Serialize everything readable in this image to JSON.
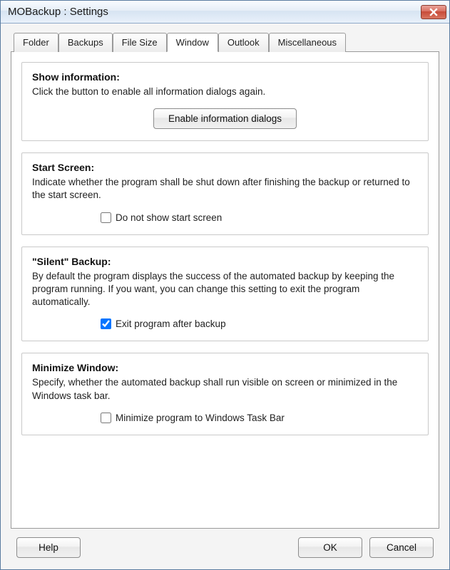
{
  "window": {
    "title": "MOBackup : Settings"
  },
  "tabs": {
    "folder": "Folder",
    "backups": "Backups",
    "filesize": "File Size",
    "window": "Window",
    "outlook": "Outlook",
    "misc": "Miscellaneous",
    "active": "window"
  },
  "groups": {
    "showInfo": {
      "title": "Show information:",
      "desc": "Click the button to enable all information dialogs again.",
      "button": "Enable information dialogs"
    },
    "startScreen": {
      "title": "Start Screen:",
      "desc": "Indicate whether the program shall be shut down after finishing the backup or returned to the start screen.",
      "checkboxLabel": "Do not show start screen",
      "checked": false
    },
    "silentBackup": {
      "title": "\"Silent\" Backup:",
      "desc": "By default the program displays the success of the automated backup by keeping the program running. If you want, you can change this setting to exit the program automatically.",
      "checkboxLabel": "Exit program after backup",
      "checked": true
    },
    "minimize": {
      "title": "Minimize Window:",
      "desc": "Specify, whether the automated backup shall run visible on screen or minimized in the Windows task bar.",
      "checkboxLabel": "Minimize program to Windows Task Bar",
      "checked": false
    }
  },
  "footer": {
    "help": "Help",
    "ok": "OK",
    "cancel": "Cancel"
  }
}
